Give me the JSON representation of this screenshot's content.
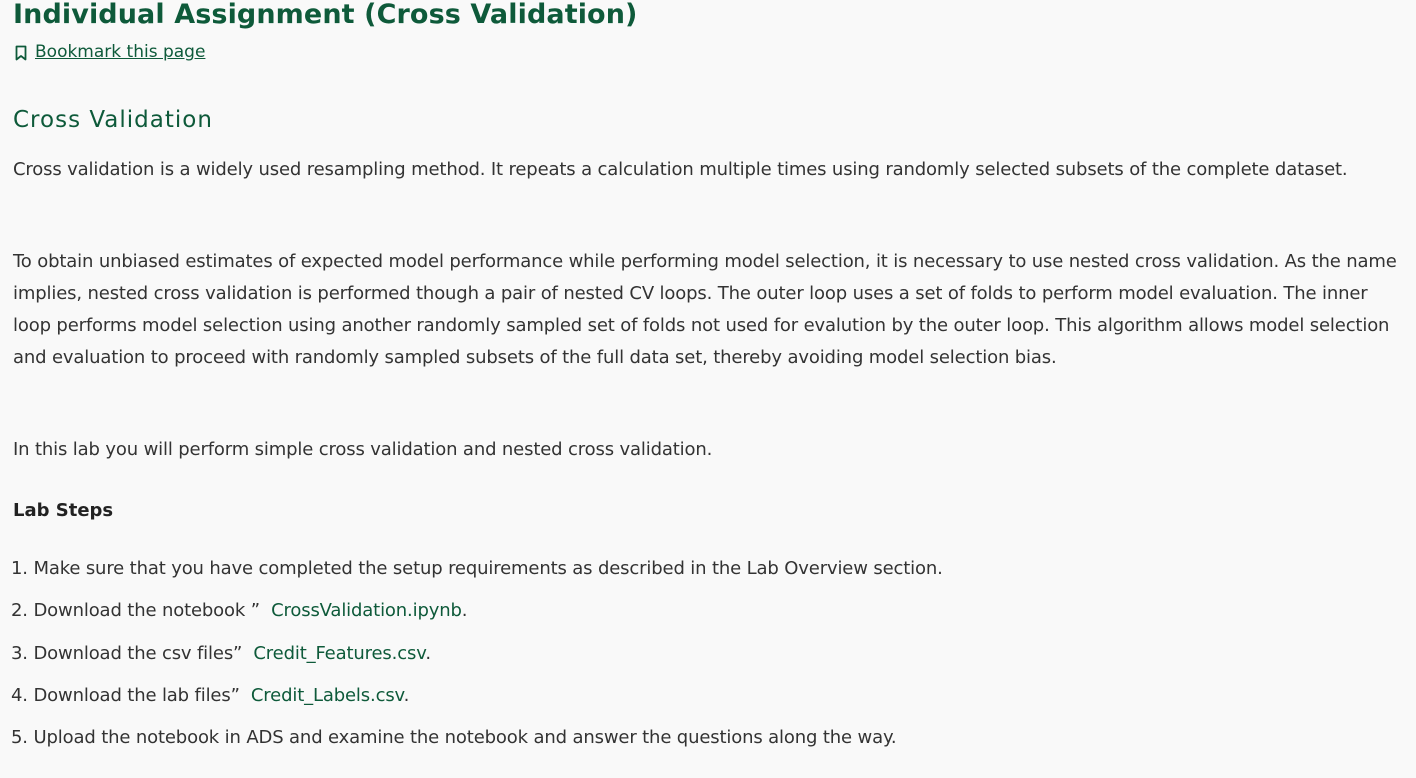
{
  "header": {
    "title": "Individual Assignment (Cross Validation)",
    "bookmark_label": "Bookmark this page",
    "bookmark_icon": "bookmark-icon"
  },
  "section": {
    "heading": "Cross Validation",
    "paragraphs": [
      "Cross validation is a widely used resampling method. It repeats a calculation multiple times using randomly selected subsets of the complete dataset.",
      "To obtain unbiased estimates of expected model performance while performing model selection, it is necessary to use nested cross validation. As the name implies, nested cross validation is performed though a pair of nested CV loops. The outer loop uses a set of folds to perform model evaluation. The inner loop performs model selection using another randomly sampled set of folds not used for evalution by the outer loop. This algorithm allows model selection and evaluation to proceed with randomly sampled subsets of the full data set, thereby avoiding model selection bias.",
      "In this lab you will perform simple cross validation and nested cross validation."
    ]
  },
  "lab_steps": {
    "heading": "Lab Steps",
    "steps": [
      {
        "prefix": "1. Make sure that you have completed the setup requirements as described in the Lab Overview section.",
        "link": "",
        "suffix": ""
      },
      {
        "prefix": "2. Download the notebook ”  ",
        "link": "CrossValidation.ipynb",
        "suffix": "."
      },
      {
        "prefix": "3. Download the csv files”  ",
        "link": "Credit_Features.csv",
        "suffix": "."
      },
      {
        "prefix": "4. Download the lab files”  ",
        "link": "Credit_Labels.csv",
        "suffix": "."
      },
      {
        "prefix": "5. Upload the notebook in ADS and examine the notebook and answer the questions along the way.",
        "link": "",
        "suffix": ""
      }
    ]
  },
  "colors": {
    "accent": "#0e5a3a",
    "text": "#333333",
    "background": "#f9f9f9"
  }
}
